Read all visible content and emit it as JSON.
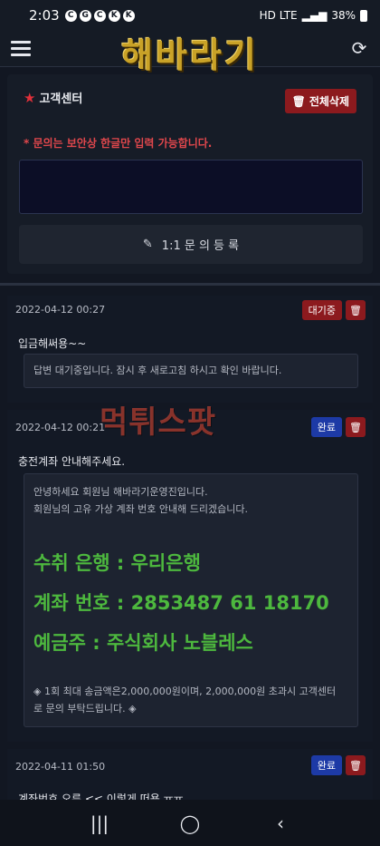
{
  "status_bar": {
    "time": "2:03",
    "notifications": [
      "C",
      "G",
      "C",
      "K",
      "K"
    ],
    "signal": "HD LTE",
    "battery": "38%"
  },
  "app": {
    "title": "해바라기"
  },
  "cs": {
    "title": "고객센터",
    "delete_all": "전체삭제",
    "warning": "* 문의는 보안상 한글만 입력 가능합니다.",
    "input_value": "",
    "register": "1:1 문 의 등 록"
  },
  "posts": [
    {
      "date": "2022-04-12 00:27",
      "status": "대기중",
      "question": "입금해써용~~",
      "answer_lines": [
        "답변 대기중입니다. 잠시 후 새로고침 하시고 확인 바랍니다."
      ]
    },
    {
      "date": "2022-04-12 00:21",
      "status": "완료",
      "question": "충전계좌 안내해주세요.",
      "answer_lines": [
        "안녕하세요 회원님 해바라기운영진입니다.",
        "회원님의 고유 가상 계좌 번호 안내해 드리겠습니다."
      ],
      "account": {
        "bank": "수취 은행 : 우리은행",
        "number": "계좌 번호 : 2853487 61 18170",
        "holder": "예금주 : 주식회사 노블레스"
      },
      "notice_lines": [
        "◈ 1회 최대 송금액은2,000,000원이며, 2,000,000원 초과시 고객센터",
        "로 문의 부탁드립니다. ◈"
      ]
    },
    {
      "date": "2022-04-11 01:50",
      "status": "완료",
      "question": "계좌번호 오류 << 이렇게 떠용 ㅠㅠ"
    }
  ],
  "watermark": "먹튀스팟",
  "colors": {
    "accent_red": "#8c1a1e",
    "accent_blue": "#1d3aa6",
    "green_text": "#4db83e",
    "warning": "#e0474c",
    "logo_gold": "#c9a227"
  },
  "icons": {
    "menu": "hamburger-icon",
    "refresh": "refresh-icon",
    "star": "star-icon",
    "trash": "trash-icon",
    "pencil": "pencil-icon"
  }
}
